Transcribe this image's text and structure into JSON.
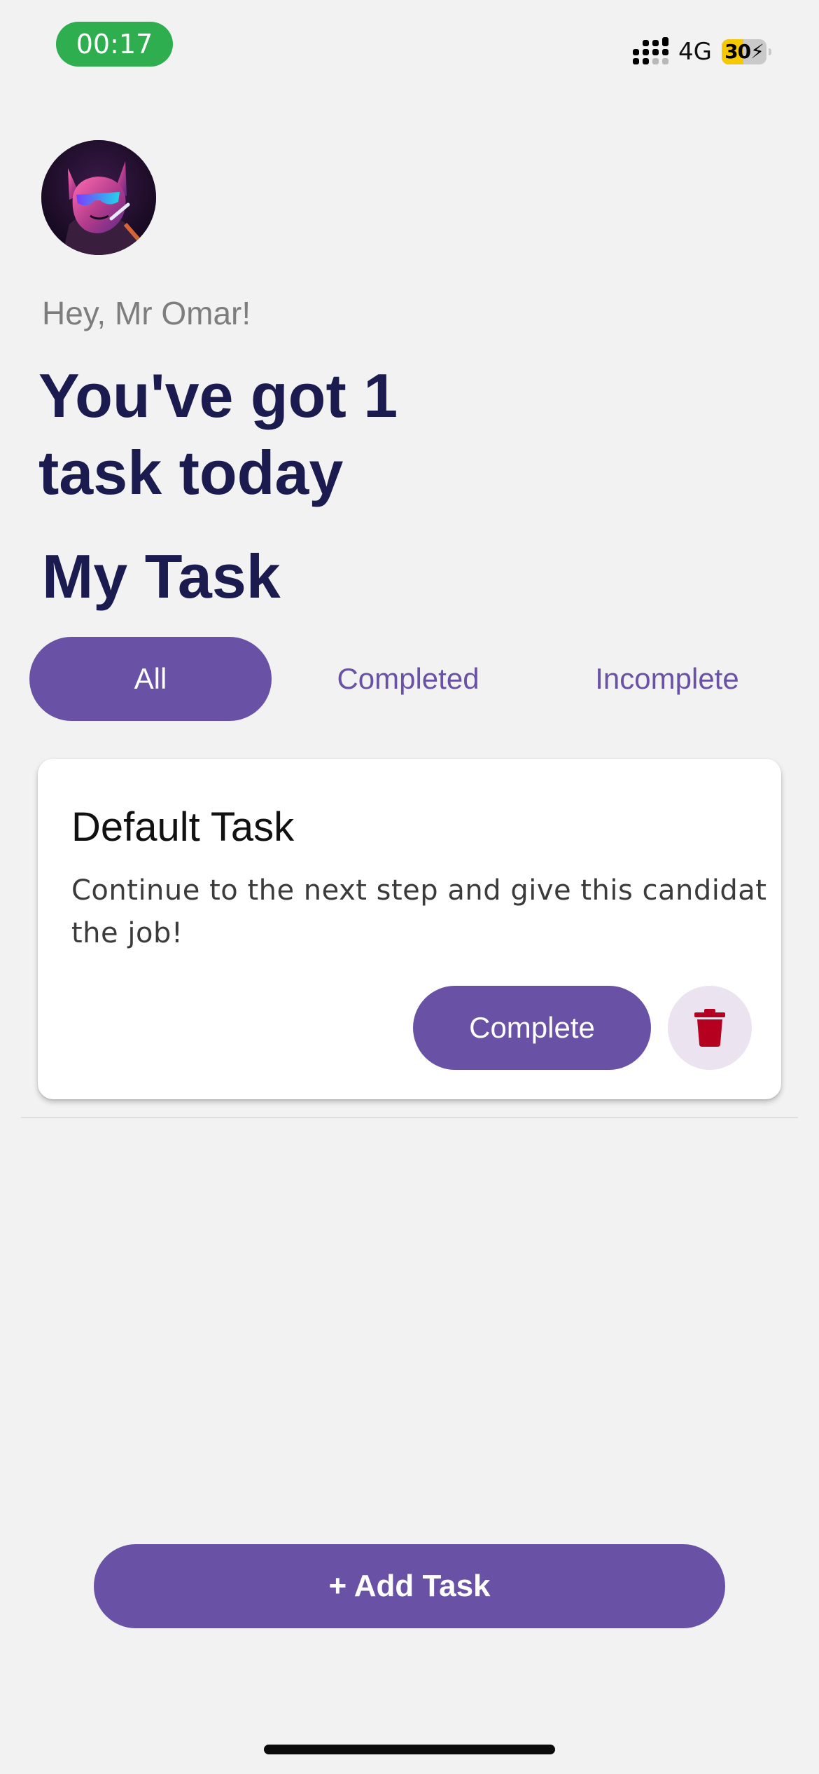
{
  "status_bar": {
    "time": "00:17",
    "network": "4G",
    "battery": "30",
    "battery_level": 0.3,
    "colors": {
      "time_pill": "#2eae4f",
      "battery": "#f6c800"
    }
  },
  "header": {
    "avatar": "avatar-image",
    "greeting": "Hey, Mr Omar!",
    "headline": "You've got 1 task today",
    "section_title": "My Task"
  },
  "filters": {
    "items": [
      {
        "label": "All",
        "selected": true
      },
      {
        "label": "Completed",
        "selected": false
      },
      {
        "label": "Incomplete",
        "selected": false
      }
    ]
  },
  "tasks": [
    {
      "title": "Default Task",
      "description": "Continue to the next step and give this candidat the job!",
      "complete_label": "Complete",
      "delete_icon": "trash-icon"
    }
  ],
  "add_task": {
    "label": "+ Add Task"
  },
  "colors": {
    "accent": "#6952a6",
    "heading": "#1c1b4f",
    "delete_icon": "#b5001f",
    "background": "#f2f2f3"
  }
}
